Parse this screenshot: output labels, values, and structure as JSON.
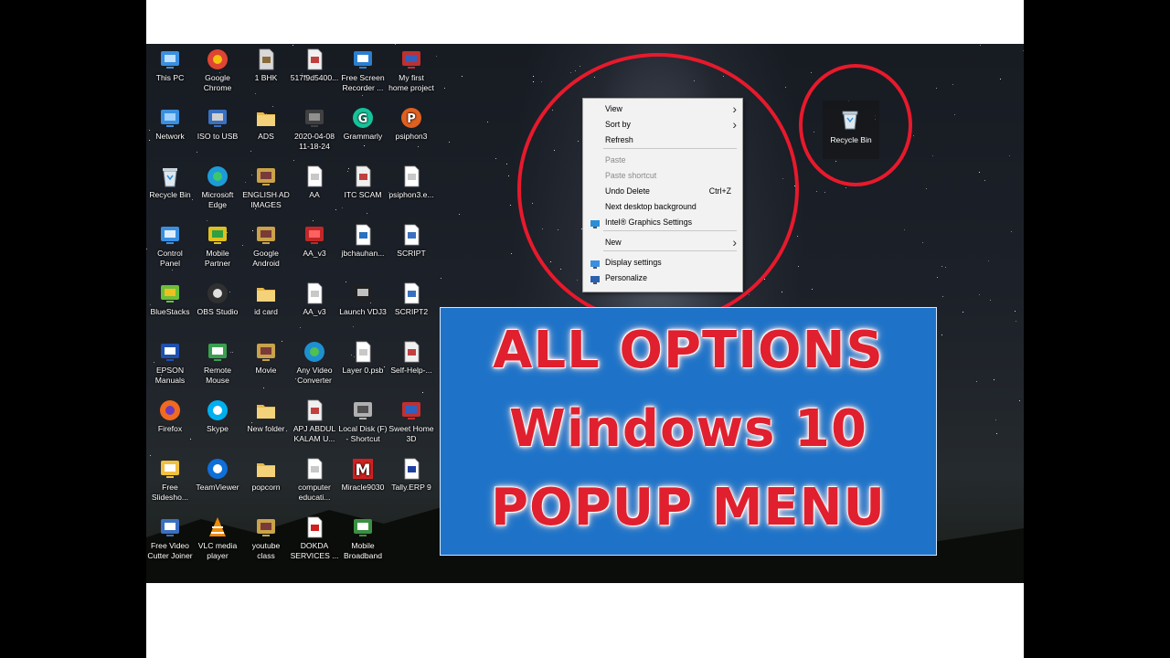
{
  "desktop_icons": [
    {
      "label": "This PC",
      "icon": "computer-icon"
    },
    {
      "label": "Google\nChrome",
      "icon": "chrome-icon"
    },
    {
      "label": "1 BHK",
      "icon": "file-icon"
    },
    {
      "label": "517f9d5400...",
      "icon": "image-file-icon"
    },
    {
      "label": "Free Screen\nRecorder ...",
      "icon": "recorder-icon"
    },
    {
      "label": "My first\nhome project",
      "icon": "home-design-icon"
    },
    {
      "label": "Network",
      "icon": "network-icon"
    },
    {
      "label": "ISO to USB",
      "icon": "usb-icon"
    },
    {
      "label": "ADS",
      "icon": "folder-icon"
    },
    {
      "label": "2020-04-08\n11-18-24",
      "icon": "video-file-icon"
    },
    {
      "label": "Grammarly",
      "icon": "grammarly-icon"
    },
    {
      "label": "psiphon3",
      "icon": "psiphon-icon"
    },
    {
      "label": "Recycle Bin",
      "icon": "recycle-bin-icon"
    },
    {
      "label": "Microsoft\nEdge",
      "icon": "edge-icon"
    },
    {
      "label": "ENGLISH AD\nIMAGES",
      "icon": "archive-icon"
    },
    {
      "label": "AA",
      "icon": "document-icon"
    },
    {
      "label": "ITC SCAM",
      "icon": "image-file-icon"
    },
    {
      "label": "psiphon3.e...",
      "icon": "document-icon"
    },
    {
      "label": "Control\nPanel",
      "icon": "control-panel-icon"
    },
    {
      "label": "Mobile\nPartner",
      "icon": "mobile-partner-icon"
    },
    {
      "label": "Google\nAndroid",
      "icon": "archive-icon"
    },
    {
      "label": "AA_v3",
      "icon": "autocad-icon"
    },
    {
      "label": "jbchauhan...",
      "icon": "window-icon"
    },
    {
      "label": "SCRIPT",
      "icon": "script-icon"
    },
    {
      "label": "BlueStacks",
      "icon": "bluestacks-icon"
    },
    {
      "label": "OBS Studio",
      "icon": "obs-icon"
    },
    {
      "label": "id card",
      "icon": "folder-icon"
    },
    {
      "label": "AA_v3",
      "icon": "document-icon"
    },
    {
      "label": "Launch VDJ3",
      "icon": "vdj-icon"
    },
    {
      "label": "SCRIPT2",
      "icon": "script-icon"
    },
    {
      "label": "EPSON\nManuals",
      "icon": "epson-icon"
    },
    {
      "label": "Remote\nMouse",
      "icon": "remote-mouse-icon"
    },
    {
      "label": "Movie",
      "icon": "archive-icon"
    },
    {
      "label": "Any Video\nConverter",
      "icon": "video-converter-icon"
    },
    {
      "label": "Layer 0.psb",
      "icon": "document-icon"
    },
    {
      "label": "Self-Help-...",
      "icon": "image-file-icon"
    },
    {
      "label": "Firefox",
      "icon": "firefox-icon"
    },
    {
      "label": "Skype",
      "icon": "skype-icon"
    },
    {
      "label": "New folder",
      "icon": "folder-icon"
    },
    {
      "label": "APJ ABDUL\nKALAM U...",
      "icon": "image-file-icon"
    },
    {
      "label": "Local Disk (F)\n- Shortcut",
      "icon": "disk-icon"
    },
    {
      "label": "Sweet Home\n3D",
      "icon": "home-design-icon"
    },
    {
      "label": "Free\nSlidesho...",
      "icon": "slideshow-icon"
    },
    {
      "label": "TeamViewer",
      "icon": "teamviewer-icon"
    },
    {
      "label": "popcorn",
      "icon": "folder-icon"
    },
    {
      "label": "computer\neducati...",
      "icon": "document-icon"
    },
    {
      "label": "Miracle9030",
      "icon": "miracle-icon"
    },
    {
      "label": "Tally.ERP 9",
      "icon": "tally-icon"
    },
    {
      "label": "Free Video\nCutter Joiner",
      "icon": "video-cutter-icon"
    },
    {
      "label": "VLC media\nplayer",
      "icon": "vlc-icon"
    },
    {
      "label": "youtube\nclass",
      "icon": "archive-icon"
    },
    {
      "label": "DOKDA\nSERVICES ...",
      "icon": "pdf-icon"
    },
    {
      "label": "Mobile\nBroadband",
      "icon": "broadband-icon"
    }
  ],
  "context_menu": {
    "items": [
      {
        "label": "View",
        "shortcut": "",
        "submenu": true,
        "disabled": false,
        "icon": ""
      },
      {
        "label": "Sort by",
        "shortcut": "",
        "submenu": true,
        "disabled": false,
        "icon": ""
      },
      {
        "label": "Refresh",
        "shortcut": "",
        "submenu": false,
        "disabled": false,
        "icon": ""
      },
      {
        "label": "Paste",
        "shortcut": "",
        "submenu": false,
        "disabled": true,
        "icon": ""
      },
      {
        "label": "Paste shortcut",
        "shortcut": "",
        "submenu": false,
        "disabled": true,
        "icon": ""
      },
      {
        "label": "Undo Delete",
        "shortcut": "Ctrl+Z",
        "submenu": false,
        "disabled": false,
        "icon": ""
      },
      {
        "label": "Next desktop background",
        "shortcut": "",
        "submenu": false,
        "disabled": false,
        "icon": ""
      },
      {
        "label": "Intel® Graphics Settings",
        "shortcut": "",
        "submenu": false,
        "disabled": false,
        "icon": "intel-graphics-icon"
      },
      {
        "label": "New",
        "shortcut": "",
        "submenu": true,
        "disabled": false,
        "icon": ""
      },
      {
        "label": "Display settings",
        "shortcut": "",
        "submenu": false,
        "disabled": false,
        "icon": "display-icon"
      },
      {
        "label": "Personalize",
        "shortcut": "",
        "submenu": false,
        "disabled": false,
        "icon": "personalize-icon"
      }
    ]
  },
  "recycle_bin_top": {
    "label": "Recycle Bin",
    "icon": "recycle-bin-icon"
  },
  "banner": {
    "line1": "ALL OPTIONS",
    "line2": "Windows 10",
    "line3": "POPUP MENU"
  },
  "colors": {
    "highlight_circle": "#e8192c",
    "banner_bg": "#1e73c8",
    "banner_text": "#e0202e"
  }
}
